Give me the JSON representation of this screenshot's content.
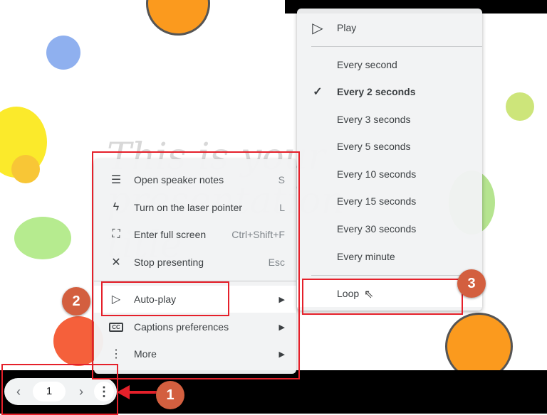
{
  "slide": {
    "title": "This is your presentation title"
  },
  "main_menu": {
    "items": [
      {
        "icon": "notes-icon",
        "label": "Open speaker notes",
        "shortcut": "S"
      },
      {
        "icon": "laser-pointer-icon",
        "label": "Turn on the laser pointer",
        "shortcut": "L"
      },
      {
        "icon": "fullscreen-icon",
        "label": "Enter full screen",
        "shortcut": "Ctrl+Shift+F"
      },
      {
        "icon": "close-icon",
        "label": "Stop presenting",
        "shortcut": "Esc"
      },
      {
        "icon": "play-icon",
        "label": "Auto-play",
        "submenu": true
      },
      {
        "icon": "captions-icon",
        "label": "Captions preferences",
        "submenu": true
      },
      {
        "icon": "more-vert-icon",
        "label": "More",
        "submenu": true
      }
    ]
  },
  "autoplay_menu": {
    "play": "Play",
    "intervals": [
      "Every second",
      "Every 2 seconds",
      "Every 3 seconds",
      "Every 5 seconds",
      "Every 10 seconds",
      "Every 15 seconds",
      "Every 30 seconds",
      "Every minute"
    ],
    "selected": "Every 2 seconds",
    "loop": "Loop"
  },
  "nav": {
    "page": "1"
  },
  "annotations": {
    "badge1": "1",
    "badge2": "2",
    "badge3": "3"
  },
  "colors": {
    "annotation_red": "#e5202a",
    "badge": "#d35f3f"
  }
}
